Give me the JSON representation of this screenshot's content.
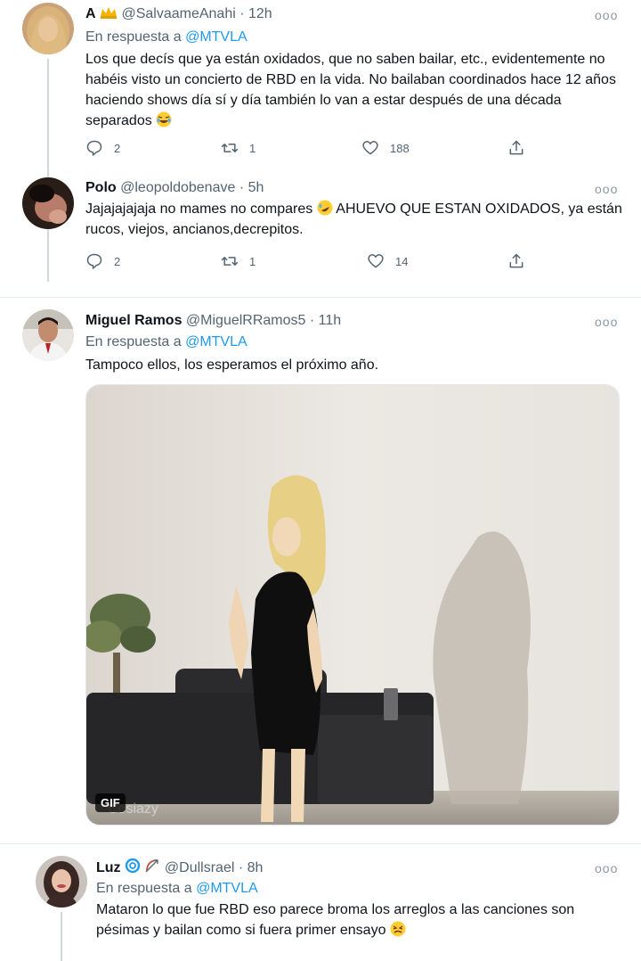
{
  "tweets": [
    {
      "name": "A",
      "handle": "@SalvaameAnahi",
      "time": "· 12h",
      "reply_label": "En respuesta a",
      "reply_to": "@MTVLA",
      "text": "Los que decís que ya están oxidados, que no saben bailar, etc., evidentemente no habéis visto un concierto de RBD en la vida. No bailaban coordinados hace 12 años haciendo shows día sí y día también lo van a estar después de una década separados",
      "replies": "2",
      "retweets": "1",
      "likes": "188"
    },
    {
      "name": "Polo",
      "handle": "@leopoldobenave",
      "time": "· 5h",
      "text_a": "Jajajajajaja no mames no compares",
      "text_b": "AHUEVO QUE ESTAN OXIDADOS, ya están rucos, viejos, ancianos,decrepitos.",
      "replies": "2",
      "retweets": "1",
      "likes": "14"
    },
    {
      "name": "Miguel Ramos",
      "handle": "@MiguelRRamos5",
      "time": "· 11h",
      "reply_label": "En respuesta a",
      "reply_to": "@MTVLA",
      "text": "Tampoco ellos, los esperamos el próximo año.",
      "gif_label": "GIF"
    },
    {
      "name": "Luz",
      "handle": "@Dullsrael",
      "time": "· 8h",
      "reply_label": "En respuesta a",
      "reply_to": "@MTVLA",
      "text": "Mataron lo que fue RBD eso parece broma los arreglos a las canciones son pésimas y bailan como si fuera primer ensayo"
    }
  ],
  "more_glyph": "ooo",
  "colors": {
    "accent": "#1d9bf0",
    "muted": "#536471",
    "text": "#0f1419"
  }
}
